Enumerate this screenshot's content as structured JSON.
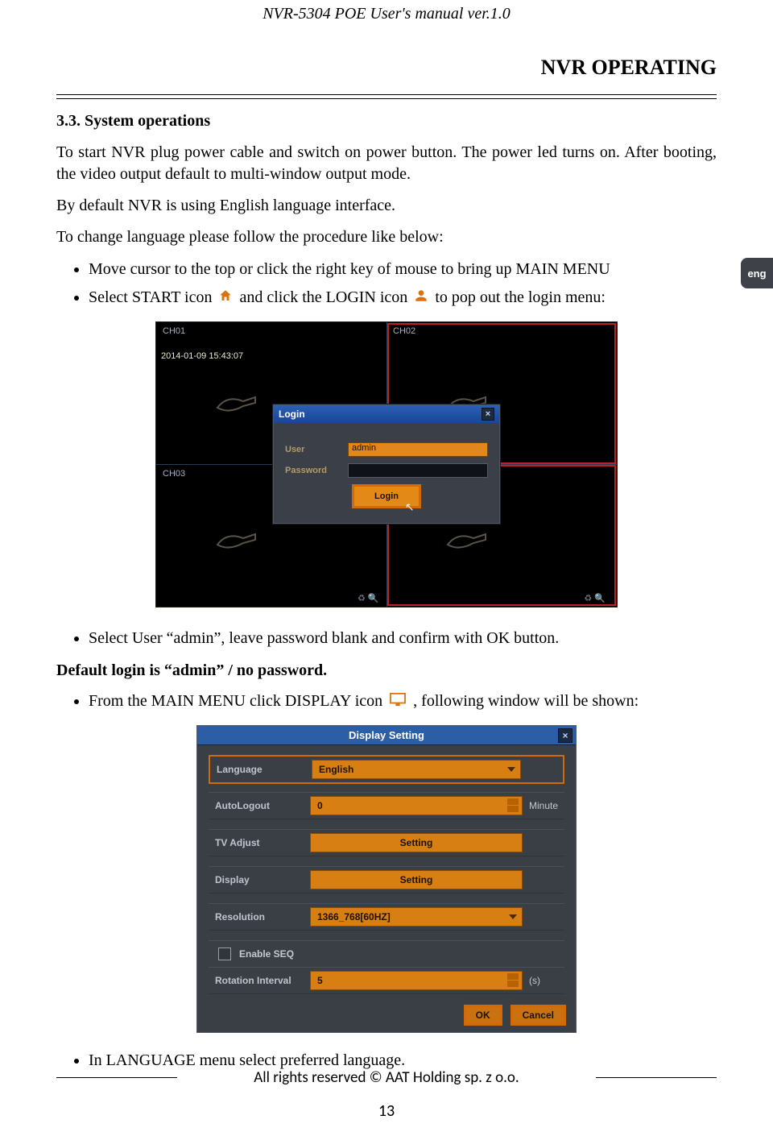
{
  "doc": {
    "header": "NVR-5304 POE User's manual ver.1.0",
    "section_right": "NVR OPERATING",
    "subsection": "3.3. System operations",
    "para1": "To start NVR plug power cable and switch on power button. The power led turns on. After booting, the video output default to multi-window output mode.",
    "para2": "By default NVR is using English language interface.",
    "para3": "To change language please follow the procedure like below:",
    "bullet1": "Move cursor to the top or click the right key of mouse to bring up MAIN MENU",
    "bullet2_a": "Select START icon ",
    "bullet2_b": " and click the LOGIN icon ",
    "bullet2_c": " to pop out the login menu:",
    "bullet3": "Select User “admin”, leave password blank and confirm with OK button.",
    "default_login": "Default login is “admin” / no password.",
    "bullet4_a": "From the MAIN MENU click  DISPLAY icon ",
    "bullet4_b": " , following window will be shown:",
    "bullet5": "In LANGUAGE  menu select preferred language.",
    "footer_copy": "All rights reserved © AAT Holding sp. z o.o.",
    "page_number": "13"
  },
  "side_tab": {
    "label": "eng"
  },
  "login_shot": {
    "ch01": "CH01",
    "ch02": "CH02",
    "ch03": "CH03",
    "timestamp": "2014-01-09  15:43:07",
    "dialog_title": "Login",
    "user_label": "User",
    "user_value": "admin",
    "password_label": "Password",
    "login_btn": "Login"
  },
  "display_shot": {
    "title": "Display Setting",
    "rows": {
      "language_label": "Language",
      "language_value": "English",
      "autologout_label": "AutoLogout",
      "autologout_value": "0",
      "autologout_unit": "Minute",
      "tvadjust_label": "TV Adjust",
      "tvadjust_value": "Setting",
      "display_label": "Display",
      "display_value": "Setting",
      "resolution_label": "Resolution",
      "resolution_value": "1366_768[60HZ]",
      "enable_seq_label": "Enable SEQ",
      "rotation_label": "Rotation Interval",
      "rotation_value": "5",
      "rotation_unit": "(s)"
    },
    "ok_btn": "OK",
    "cancel_btn": "Cancel"
  }
}
